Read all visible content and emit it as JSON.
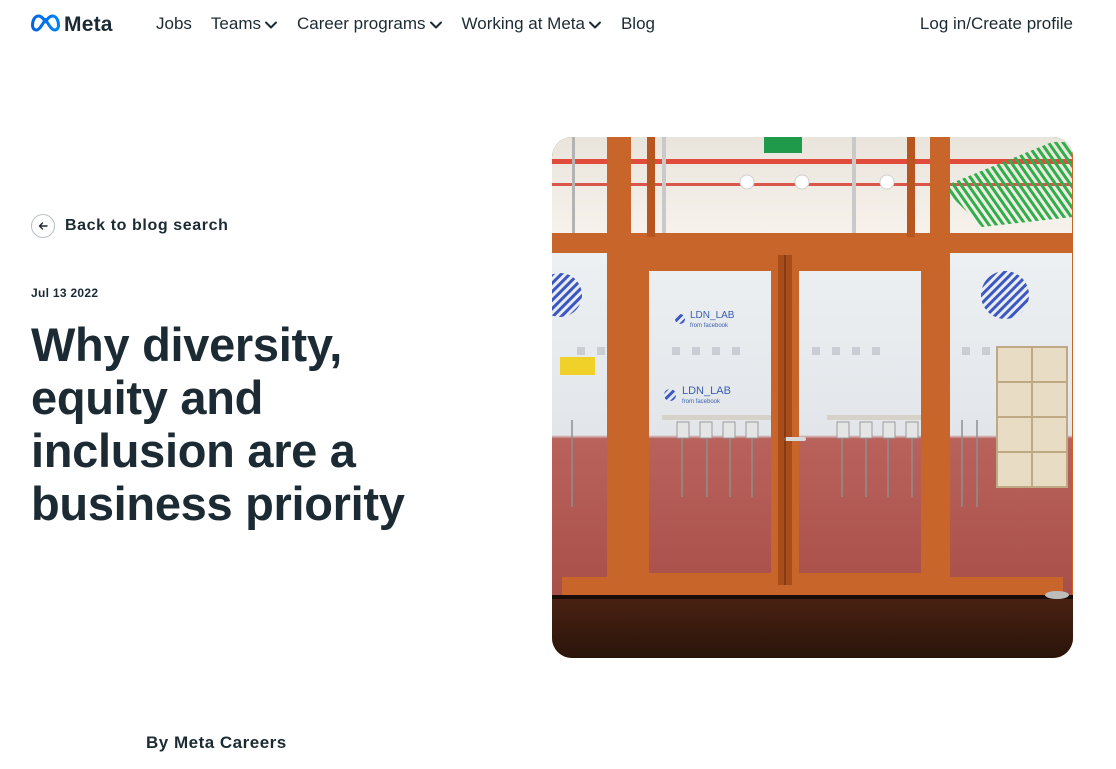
{
  "header": {
    "brand": "Meta",
    "nav": [
      {
        "label": "Jobs",
        "has_dropdown": false
      },
      {
        "label": "Teams",
        "has_dropdown": true
      },
      {
        "label": "Career programs",
        "has_dropdown": true
      },
      {
        "label": "Working at Meta",
        "has_dropdown": true
      },
      {
        "label": "Blog",
        "has_dropdown": false
      }
    ],
    "login": "Log in/Create profile"
  },
  "article": {
    "back_link": "Back to blog search",
    "date": "Jul 13 2022",
    "title": "Why diversity, equity and inclusion are a business priority",
    "byline": "By Meta Careers",
    "hero_image": {
      "signs": [
        "LDN_LAB",
        "from facebook",
        "LDN_LAB",
        "from facebook"
      ]
    }
  },
  "colors": {
    "text": "#1c2b33",
    "meta_blue": "#0668e1",
    "door_wood": "#c8652a",
    "carpet": "#b4524d"
  },
  "icons": [
    "meta-logo-icon",
    "chevron-down-icon",
    "arrow-left-icon"
  ]
}
